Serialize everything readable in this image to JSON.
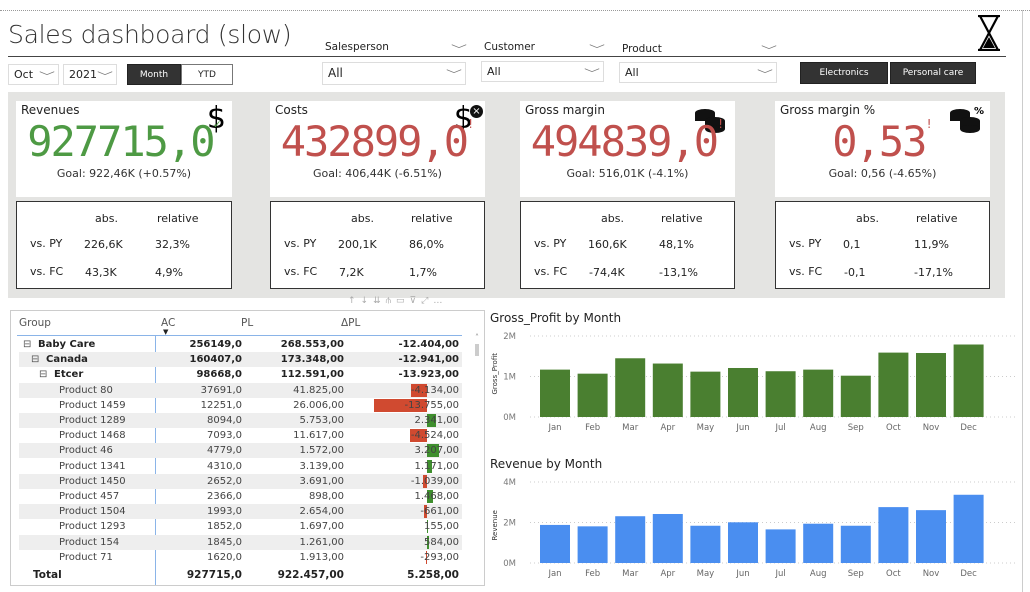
{
  "header": {
    "title": "Sales dashboard (slow)"
  },
  "filters": {
    "month": "Oct",
    "year": "2021",
    "period_buttons": [
      "Month",
      "YTD"
    ],
    "salesperson": {
      "label": "Salesperson",
      "value": "All"
    },
    "customer": {
      "label": "Customer",
      "value": "All"
    },
    "product": {
      "label": "Product",
      "value": "All"
    },
    "category_buttons": [
      "Electronics",
      "Personal care"
    ]
  },
  "colors": {
    "good": "#4e9a44",
    "bad": "#c0504d",
    "gp_bar": "#4a7f30",
    "rev_bar": "#4a8ef0",
    "neg_bar": "#d04a30",
    "pos_bar": "#3f8f2e"
  },
  "kpis": [
    {
      "title": "Revenues",
      "value": "927715,0",
      "status": "✓",
      "status_color": "#4e9a44",
      "goal": "Goal: 922,46K (+0.57%)",
      "icon": "dollar-icon",
      "icon_glyph": "$",
      "vs_py_abs": "226,6K",
      "vs_py_rel": "32,3%",
      "vs_fc_abs": "43,3K",
      "vs_fc_rel": "4,9%"
    },
    {
      "title": "Costs",
      "value": "432899,0",
      "status": "!",
      "status_color": "#c0504d",
      "goal": "Goal: 406,44K (-6.51%)",
      "icon": "dollar-cancel-icon",
      "icon_glyph": "$",
      "vs_py_abs": "200,1K",
      "vs_py_rel": "86,0%",
      "vs_fc_abs": "7,2K",
      "vs_fc_rel": "1,7%"
    },
    {
      "title": "Gross margin",
      "value": "494839,0",
      "status": "!",
      "status_color": "#c0504d",
      "goal": "Goal: 516,01K (-4.1%)",
      "icon": "coins-icon",
      "icon_glyph": "",
      "vs_py_abs": "160,6K",
      "vs_py_rel": "48,1%",
      "vs_fc_abs": "-74,4K",
      "vs_fc_rel": "-13,1%"
    },
    {
      "title": "Gross margin %",
      "value": "0,53",
      "status": "!",
      "status_color": "#c0504d",
      "goal": "Goal: 0,56 (-4.65%)",
      "icon": "coins-percent-icon",
      "icon_glyph": "%",
      "vs_py_abs": "0,1",
      "vs_py_rel": "11,9%",
      "vs_fc_abs": "-0,1",
      "vs_fc_rel": "-17,1%"
    }
  ],
  "kpi_labels": {
    "abs": "abs.",
    "relative": "relative",
    "vs_py": "vs. PY",
    "vs_fc": "vs. FC"
  },
  "table": {
    "headers": [
      "Group",
      "AC",
      "PL",
      "ΔPL"
    ],
    "rows": [
      {
        "level": 0,
        "expand": "⊟",
        "group": "Baby Care",
        "ac": "256149,0",
        "pl": "268.553,00",
        "dpl": "-12.404,00",
        "bold": true
      },
      {
        "level": 1,
        "expand": "⊟",
        "group": "Canada",
        "ac": "160407,0",
        "pl": "173.348,00",
        "dpl": "-12.941,00",
        "bold": true
      },
      {
        "level": 2,
        "expand": "⊟",
        "group": "Etcer",
        "ac": "98668,0",
        "pl": "112.591,00",
        "dpl": "-13.923,00",
        "bold": true
      },
      {
        "level": 3,
        "group": "Product 80",
        "ac": "37691,0",
        "pl": "41.825,00",
        "dpl": "-4.134,00",
        "delta": -4134
      },
      {
        "level": 3,
        "group": "Product 1459",
        "ac": "12251,0",
        "pl": "26.006,00",
        "dpl": "-13.755,00",
        "delta": -13755
      },
      {
        "level": 3,
        "group": "Product 1289",
        "ac": "8094,0",
        "pl": "5.753,00",
        "dpl": "2.341,00",
        "delta": 2341
      },
      {
        "level": 3,
        "group": "Product 1468",
        "ac": "7093,0",
        "pl": "11.617,00",
        "dpl": "-4.524,00",
        "delta": -4524
      },
      {
        "level": 3,
        "group": "Product 46",
        "ac": "4779,0",
        "pl": "1.572,00",
        "dpl": "3.207,00",
        "delta": 3207
      },
      {
        "level": 3,
        "group": "Product 1341",
        "ac": "4310,0",
        "pl": "3.139,00",
        "dpl": "1.171,00",
        "delta": 1171
      },
      {
        "level": 3,
        "group": "Product 1450",
        "ac": "2652,0",
        "pl": "3.691,00",
        "dpl": "-1.039,00",
        "delta": -1039
      },
      {
        "level": 3,
        "group": "Product 457",
        "ac": "2366,0",
        "pl": "898,00",
        "dpl": "1.468,00",
        "delta": 1468
      },
      {
        "level": 3,
        "group": "Product 1504",
        "ac": "1993,0",
        "pl": "2.654,00",
        "dpl": "-661,00",
        "delta": -661
      },
      {
        "level": 3,
        "group": "Product 1293",
        "ac": "1852,0",
        "pl": "1.697,00",
        "dpl": "155,00",
        "delta": 155
      },
      {
        "level": 3,
        "group": "Product 154",
        "ac": "1845,0",
        "pl": "1.261,00",
        "dpl": "584,00",
        "delta": 584
      },
      {
        "level": 3,
        "group": "Product 71",
        "ac": "1620,0",
        "pl": "1.913,00",
        "dpl": "-293,00",
        "delta": -293
      }
    ],
    "total": {
      "group": "Total",
      "ac": "927715,0",
      "pl": "922.457,00",
      "dpl": "5.258,00"
    }
  },
  "chart_data": [
    {
      "type": "bar",
      "title": "Gross_Profit by Month",
      "xlabel": "",
      "ylabel": "Gross_Profit",
      "ylim": [
        0,
        2
      ],
      "ticks": [
        "0M",
        "1M",
        "2M"
      ],
      "tick_values": [
        0,
        1,
        2
      ],
      "grid": true,
      "unit": "M",
      "categories": [
        "Jan",
        "Feb",
        "Mar",
        "Apr",
        "May",
        "Jun",
        "Jul",
        "Aug",
        "Sep",
        "Oct",
        "Nov",
        "Dec"
      ],
      "values": [
        1.17,
        1.07,
        1.45,
        1.32,
        1.12,
        1.21,
        1.13,
        1.17,
        1.02,
        1.59,
        1.58,
        1.79
      ]
    },
    {
      "type": "bar",
      "title": "Revenue by Month",
      "xlabel": "",
      "ylabel": "Revenue",
      "ylim": [
        0,
        4
      ],
      "ticks": [
        "0M",
        "2M",
        "4M"
      ],
      "tick_values": [
        0,
        2,
        4
      ],
      "grid": true,
      "unit": "M",
      "categories": [
        "Jan",
        "Feb",
        "Mar",
        "Apr",
        "May",
        "Jun",
        "Jul",
        "Aug",
        "Sep",
        "Oct",
        "Nov",
        "Dec"
      ],
      "values": [
        1.88,
        1.81,
        2.31,
        2.42,
        1.84,
        2.01,
        1.66,
        1.94,
        1.84,
        2.76,
        2.61,
        3.37
      ]
    }
  ]
}
